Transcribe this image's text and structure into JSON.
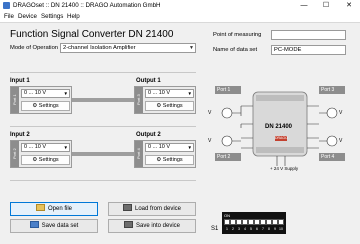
{
  "window": {
    "title": "DRAGOset :: DN 21400 :: DRAGO Automation GmbH",
    "minimize_glyph": "—",
    "maximize_glyph": "☐",
    "close_glyph": "✕"
  },
  "menu": [
    "File",
    "Device",
    "Settings",
    "Help"
  ],
  "header": {
    "title": "Function Signal Converter DN 21400",
    "mode_label": "Mode of Operation",
    "mode_value": "2-channel Isolation Amplifier",
    "point_label": "Point of measuring",
    "point_value": "",
    "dataset_label": "Name of data set",
    "dataset_value": "PC-MODE"
  },
  "channels": [
    {
      "input_label": "Input 1",
      "output_label": "Output 1",
      "input_port": {
        "tag": "Port 1",
        "range": "0 ... 10 V",
        "settings": "Settings"
      },
      "output_port": {
        "tag": "Port 3",
        "range": "0 ... 10 V",
        "settings": "Settings"
      }
    },
    {
      "input_label": "Input 2",
      "output_label": "Output 2",
      "input_port": {
        "tag": "Port 2",
        "range": "0 ... 10 V",
        "settings": "Settings"
      },
      "output_port": {
        "tag": "Port 4",
        "range": "0 ... 10 V",
        "settings": "Settings"
      }
    }
  ],
  "buttons": {
    "open_file": "Open file",
    "load_device": "Load from device",
    "save_dataset": "Save data set",
    "save_device": "Save into device"
  },
  "diagram": {
    "port1": "Port 1",
    "port2": "Port 2",
    "port3": "Port 3",
    "port4": "Port 4",
    "device": "DN 21400",
    "brand": "DRAGO",
    "supply": "+ 24 V Supply",
    "v_symbol": "V"
  },
  "dip": {
    "label": "S1",
    "on_label": "ON",
    "numbers": [
      "1",
      "2",
      "3",
      "4",
      "5",
      "6",
      "7",
      "8",
      "9",
      "10"
    ]
  },
  "colors": {
    "accent": "#0078d7",
    "port_gray": "#8d8d8d"
  }
}
